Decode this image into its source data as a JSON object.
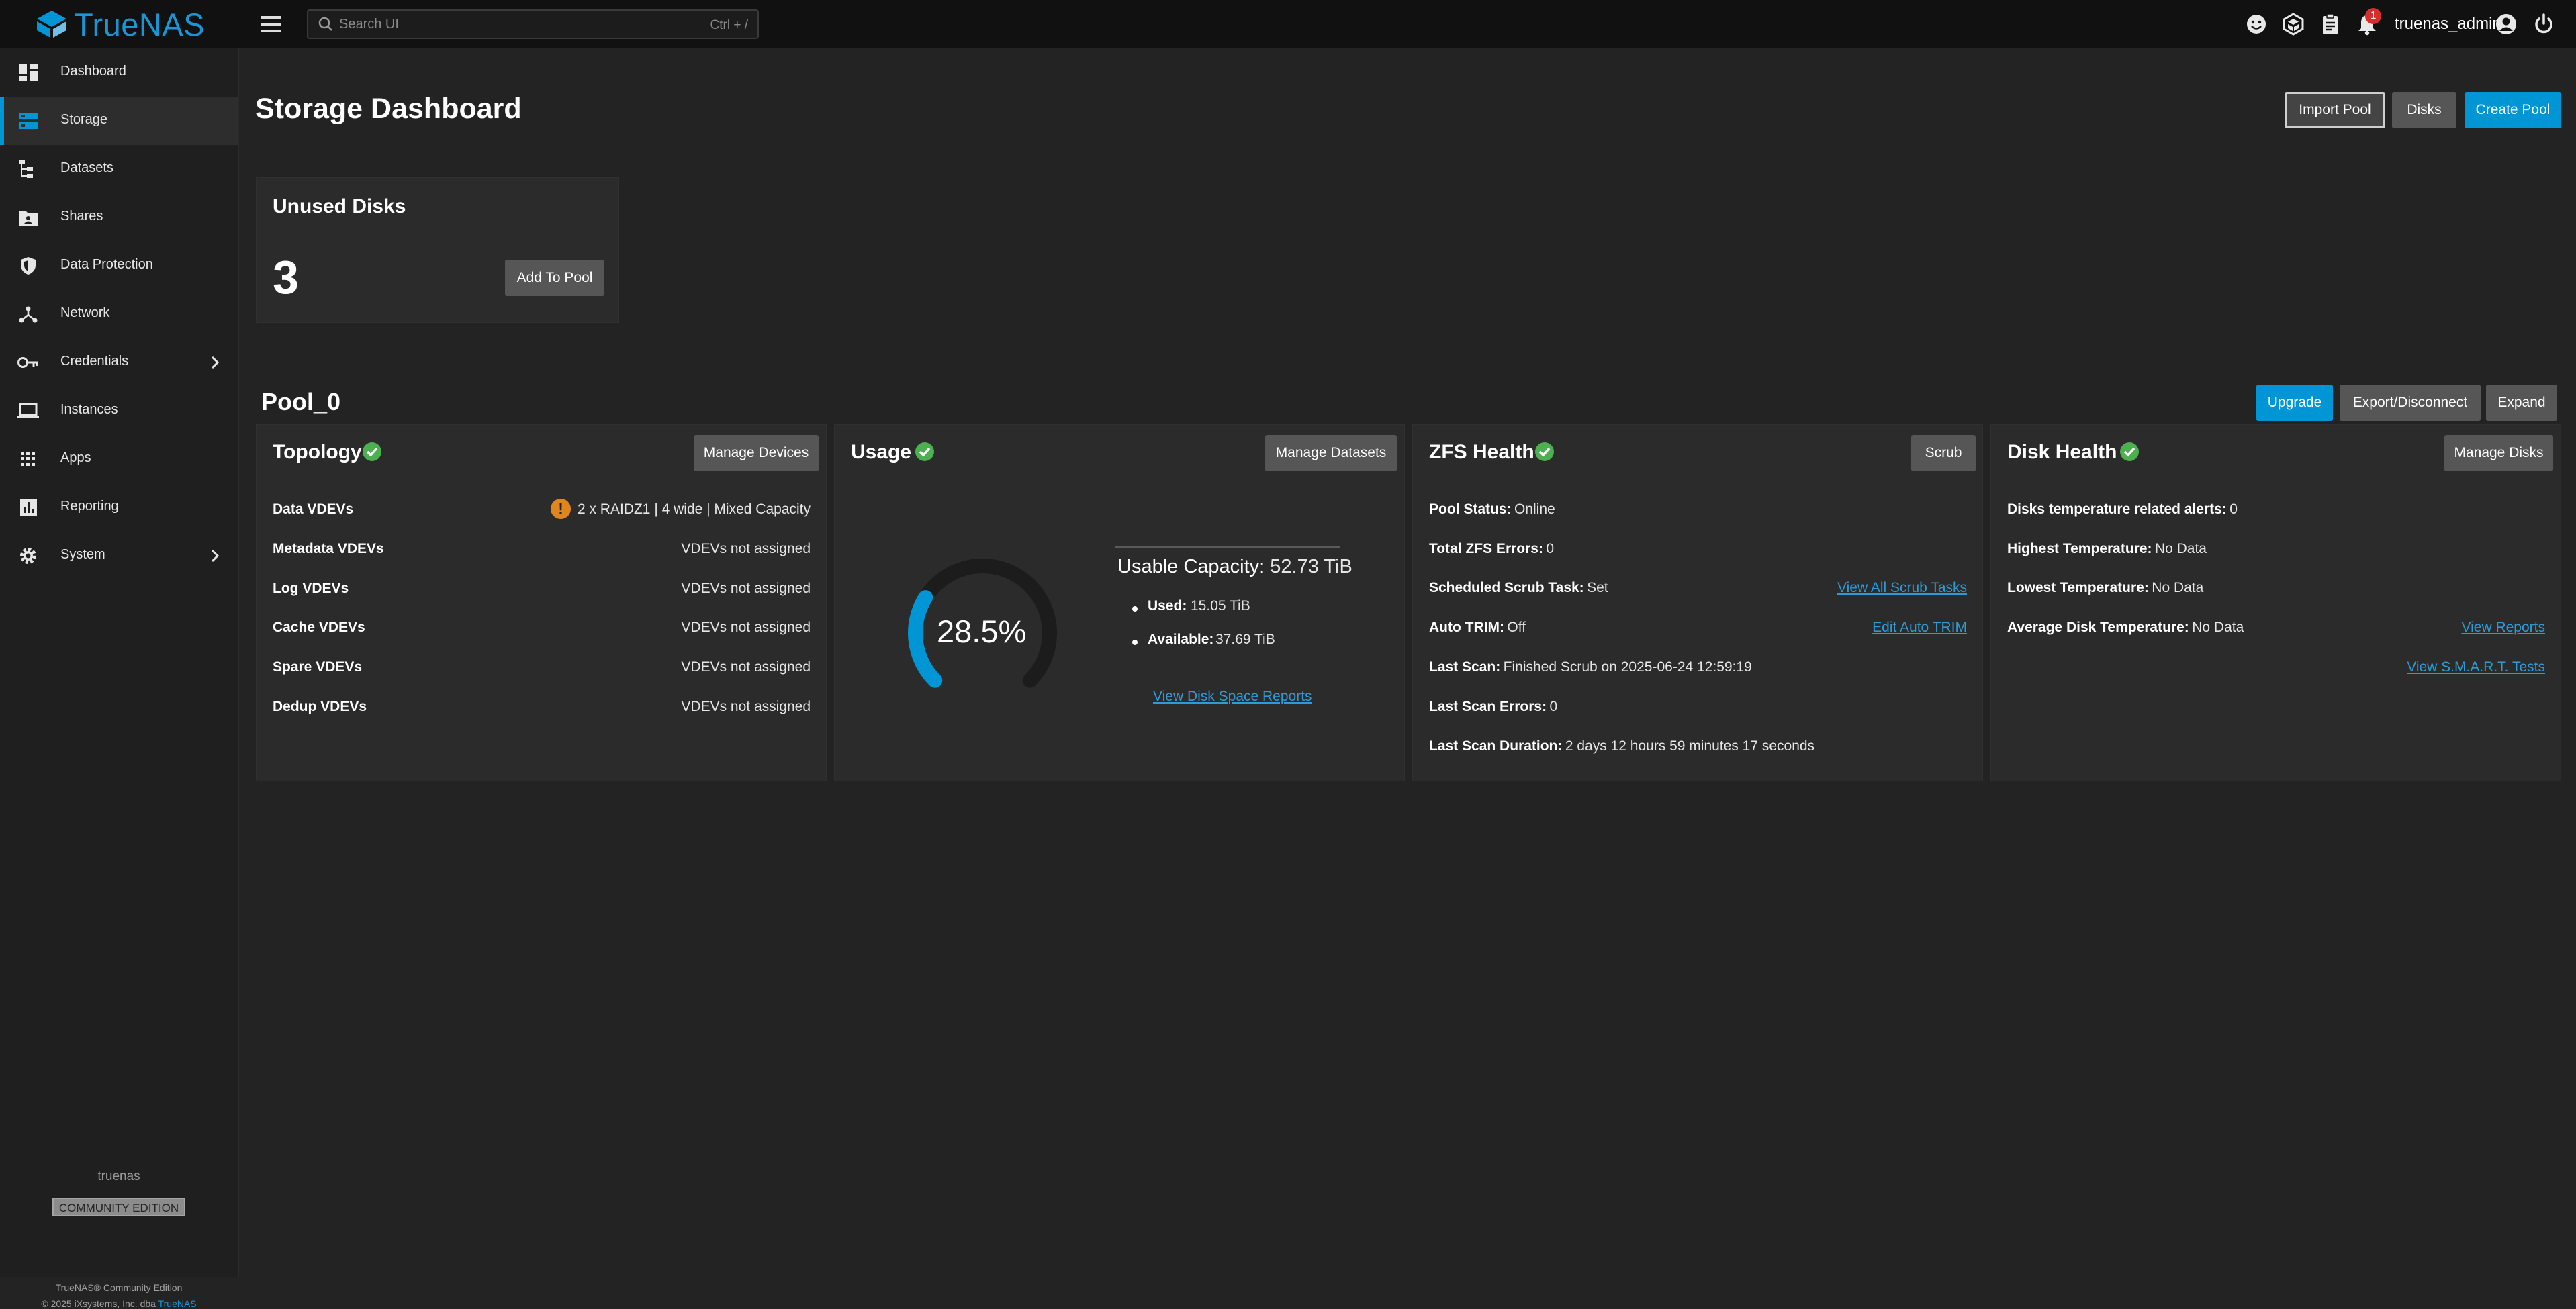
{
  "app": {
    "brand": "TrueNAS",
    "accent_color": "#0095d5",
    "ok_color": "#4caf50",
    "warning_color": "#e0861e"
  },
  "topbar": {
    "search_placeholder": "Search UI",
    "search_shortcut": "Ctrl + /",
    "notification_count": "1",
    "username": "truenas_admin",
    "icons": [
      "feedback-icon",
      "truecommand-icon",
      "jobs-icon",
      "notifications-icon",
      "account-icon",
      "power-icon"
    ]
  },
  "sidebar": {
    "items": [
      {
        "label": "Dashboard",
        "icon": "dashboard-icon",
        "active": false
      },
      {
        "label": "Storage",
        "icon": "storage-icon",
        "active": true
      },
      {
        "label": "Datasets",
        "icon": "datasets-icon",
        "active": false
      },
      {
        "label": "Shares",
        "icon": "shares-icon",
        "active": false
      },
      {
        "label": "Data Protection",
        "icon": "shield-icon",
        "active": false
      },
      {
        "label": "Network",
        "icon": "network-icon",
        "active": false
      },
      {
        "label": "Credentials",
        "icon": "key-icon",
        "active": false,
        "has_children": true
      },
      {
        "label": "Instances",
        "icon": "laptop-icon",
        "active": false
      },
      {
        "label": "Apps",
        "icon": "apps-grid-icon",
        "active": false
      },
      {
        "label": "Reporting",
        "icon": "reporting-icon",
        "active": false
      },
      {
        "label": "System",
        "icon": "gear-icon",
        "active": false,
        "has_children": true
      }
    ],
    "hostname": "truenas",
    "edition": "COMMUNITY EDITION",
    "copyright_line1": "TrueNAS® Community Edition",
    "copyright_line2": "© 2025 iXsystems, Inc. dba",
    "copyright_brand": "TrueNAS"
  },
  "page": {
    "title": "Storage Dashboard",
    "import_pool": "Import Pool",
    "disks": "Disks",
    "create_pool": "Create Pool"
  },
  "unused_disks": {
    "title": "Unused Disks",
    "count": "3",
    "add_button": "Add To Pool"
  },
  "pool": {
    "name": "Pool_0",
    "upgrade": "Upgrade",
    "export_disconnect": "Export/Disconnect",
    "expand": "Expand"
  },
  "topology": {
    "title": "Topology",
    "status": "ok",
    "button": "Manage Devices",
    "rows": [
      {
        "label": "Data VDEVs",
        "value": "2 x RAIDZ1 | 4 wide | Mixed Capacity",
        "warning": true
      },
      {
        "label": "Metadata VDEVs",
        "value": "VDEVs not assigned"
      },
      {
        "label": "Log VDEVs",
        "value": "VDEVs not assigned"
      },
      {
        "label": "Cache VDEVs",
        "value": "VDEVs not assigned"
      },
      {
        "label": "Spare VDEVs",
        "value": "VDEVs not assigned"
      },
      {
        "label": "Dedup VDEVs",
        "value": "VDEVs not assigned"
      }
    ]
  },
  "usage": {
    "title": "Usage",
    "status": "ok",
    "button": "Manage Datasets",
    "percent_label": "28.5%",
    "percent_value": 0.285,
    "capacity_label": "Usable Capacity:",
    "capacity_value": "52.73 TiB",
    "used_label": "Used:",
    "used_value": "15.05 TiB",
    "available_label": "Available:",
    "available_value": "37.69 TiB",
    "report_link": "View Disk Space Reports"
  },
  "zfs_health": {
    "title": "ZFS Health",
    "status": "ok",
    "button": "Scrub",
    "rows": [
      {
        "label": "Pool Status:",
        "value": "Online"
      },
      {
        "label": "Total ZFS Errors:",
        "value": "0"
      },
      {
        "label": "Scheduled Scrub Task:",
        "value": "Set",
        "link": "View All Scrub Tasks"
      },
      {
        "label": "Auto TRIM:",
        "value": "Off",
        "link": "Edit Auto TRIM"
      },
      {
        "label": "Last Scan:",
        "value": "Finished Scrub on 2025-06-24 12:59:19"
      },
      {
        "label": "Last Scan Errors:",
        "value": "0"
      },
      {
        "label": "Last Scan Duration:",
        "value": "2 days 12 hours 59 minutes 17 seconds"
      }
    ]
  },
  "disk_health": {
    "title": "Disk Health",
    "status": "ok",
    "button": "Manage Disks",
    "rows": [
      {
        "label": "Disks temperature related alerts:",
        "value": "0"
      },
      {
        "label": "Highest Temperature:",
        "value": "No Data"
      },
      {
        "label": "Lowest Temperature:",
        "value": "No Data"
      },
      {
        "label": "Average Disk Temperature:",
        "value": "No Data",
        "link": "View Reports"
      }
    ],
    "smart_link": "View S.M.A.R.T. Tests"
  }
}
